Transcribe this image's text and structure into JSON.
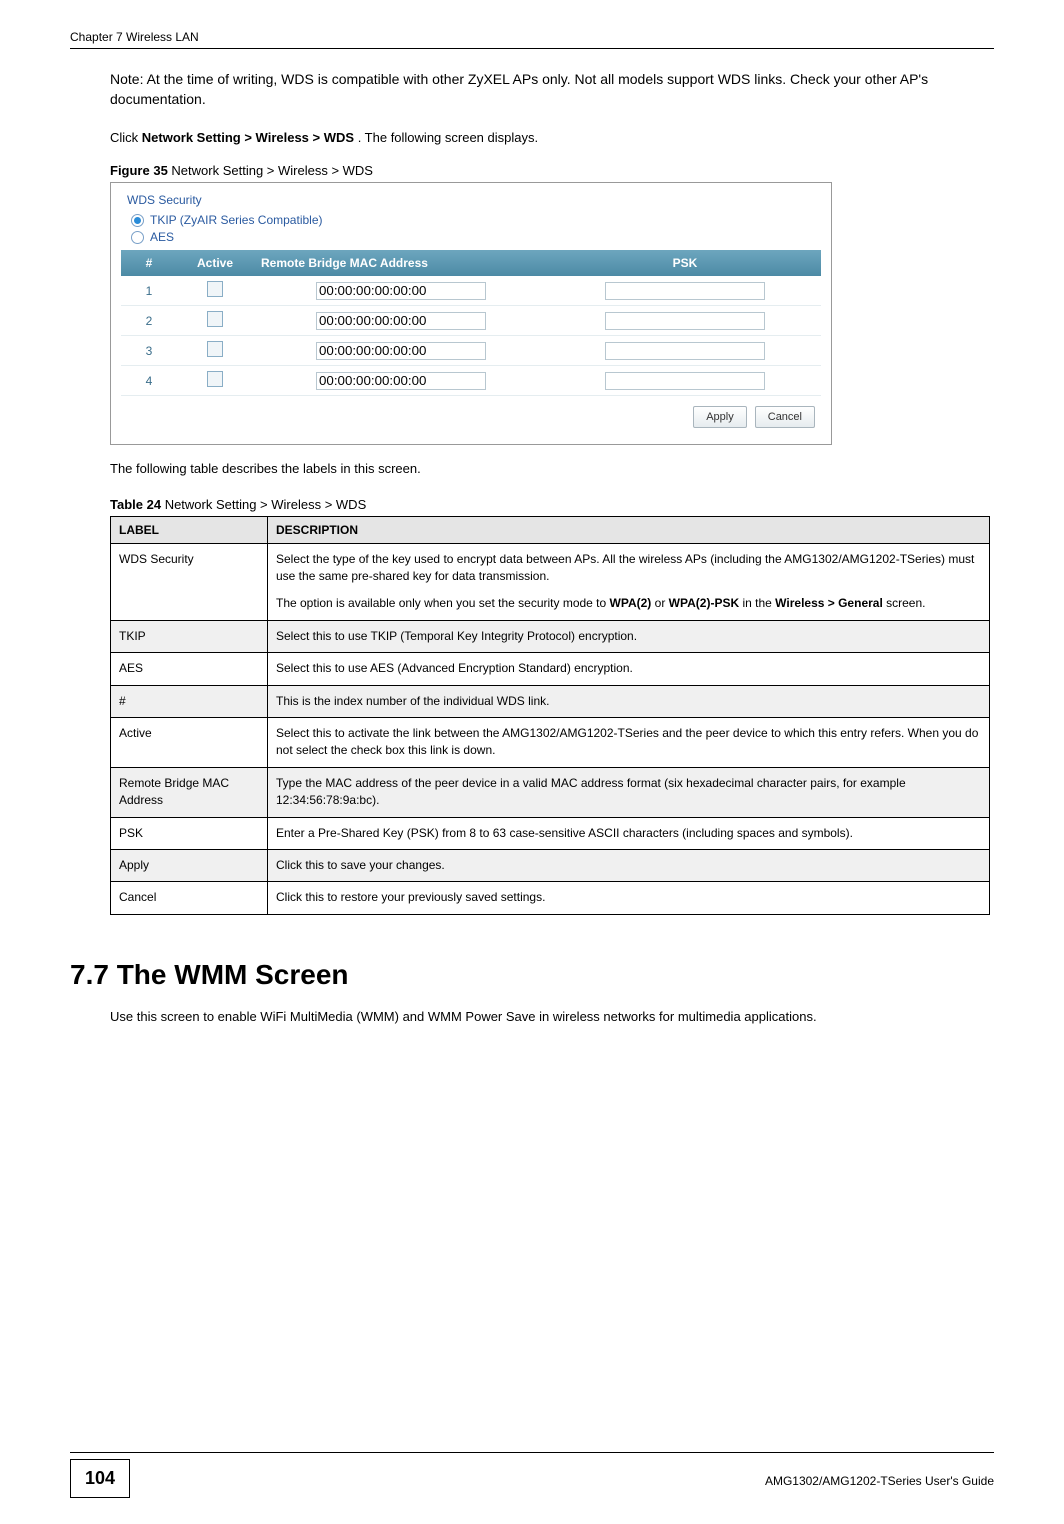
{
  "header": {
    "chapter": "Chapter 7 Wireless LAN"
  },
  "content": {
    "note": "Note: At the time of writing, WDS is compatible with other ZyXEL APs only. Not all models support WDS links. Check your other AP's documentation.",
    "nav_pre": "Click ",
    "nav_path": "Network Setting > Wireless > WDS",
    "nav_post": ". The following screen displays.",
    "figure_label": "Figure 35   ",
    "figure_title": "Network Setting > Wireless > WDS",
    "table_intro": "The following table describes the labels in this screen.",
    "table_label": "Table 24   ",
    "table_title": "Network Setting > Wireless > WDS",
    "section_heading": "7.7  The WMM Screen",
    "section_body": "Use this screen to enable WiFi MultiMedia (WMM) and WMM Power Save in wireless networks for multimedia applications."
  },
  "screenshot": {
    "title": "WDS Security",
    "radio_tkip": "TKIP (ZyAIR Series Compatible)",
    "radio_aes": "AES",
    "cols": [
      "#",
      "Active",
      "Remote Bridge MAC Address",
      "PSK"
    ],
    "rows": [
      {
        "n": "1",
        "mac": "00:00:00:00:00:00"
      },
      {
        "n": "2",
        "mac": "00:00:00:00:00:00"
      },
      {
        "n": "3",
        "mac": "00:00:00:00:00:00"
      },
      {
        "n": "4",
        "mac": "00:00:00:00:00:00"
      }
    ],
    "apply": "Apply",
    "cancel": "Cancel"
  },
  "table": {
    "header": [
      "LABEL",
      "DESCRIPTION"
    ],
    "rows": [
      {
        "label": "WDS Security",
        "p1": "Select the type of the key used to encrypt data between APs. All the wireless APs (including the AMG1302/AMG1202-TSeries) must use the same pre-shared key for data transmission.",
        "p2a": "The option is available only when you set the security mode to ",
        "b1": "WPA(2)",
        "p2b": " or ",
        "b2": "WPA(2)-PSK",
        "p2c": " in the ",
        "b3": "Wireless > General",
        "p2d": " screen."
      },
      {
        "label": "TKIP",
        "desc": "Select this to use TKIP (Temporal Key Integrity Protocol) encryption."
      },
      {
        "label": "AES",
        "desc": "Select this to use AES (Advanced Encryption Standard) encryption."
      },
      {
        "label": "#",
        "desc": "This is the index number of the individual WDS link."
      },
      {
        "label": "Active",
        "desc": "Select this to activate the link between the AMG1302/AMG1202-TSeries and the peer device to which this entry refers. When you do not select the check box this link is down."
      },
      {
        "label": "Remote Bridge MAC Address",
        "desc": "Type the MAC address of the peer device in a valid MAC address format (six hexadecimal character pairs, for example 12:34:56:78:9a:bc)."
      },
      {
        "label": "PSK",
        "desc": "Enter a Pre-Shared Key (PSK) from 8 to 63 case-sensitive ASCII characters (including spaces and symbols)."
      },
      {
        "label": "Apply",
        "desc": "Click this to save your changes."
      },
      {
        "label": "Cancel",
        "desc": "Click this to restore your previously saved settings."
      }
    ]
  },
  "footer": {
    "page": "104",
    "guide": "AMG1302/AMG1202-TSeries User's Guide"
  }
}
